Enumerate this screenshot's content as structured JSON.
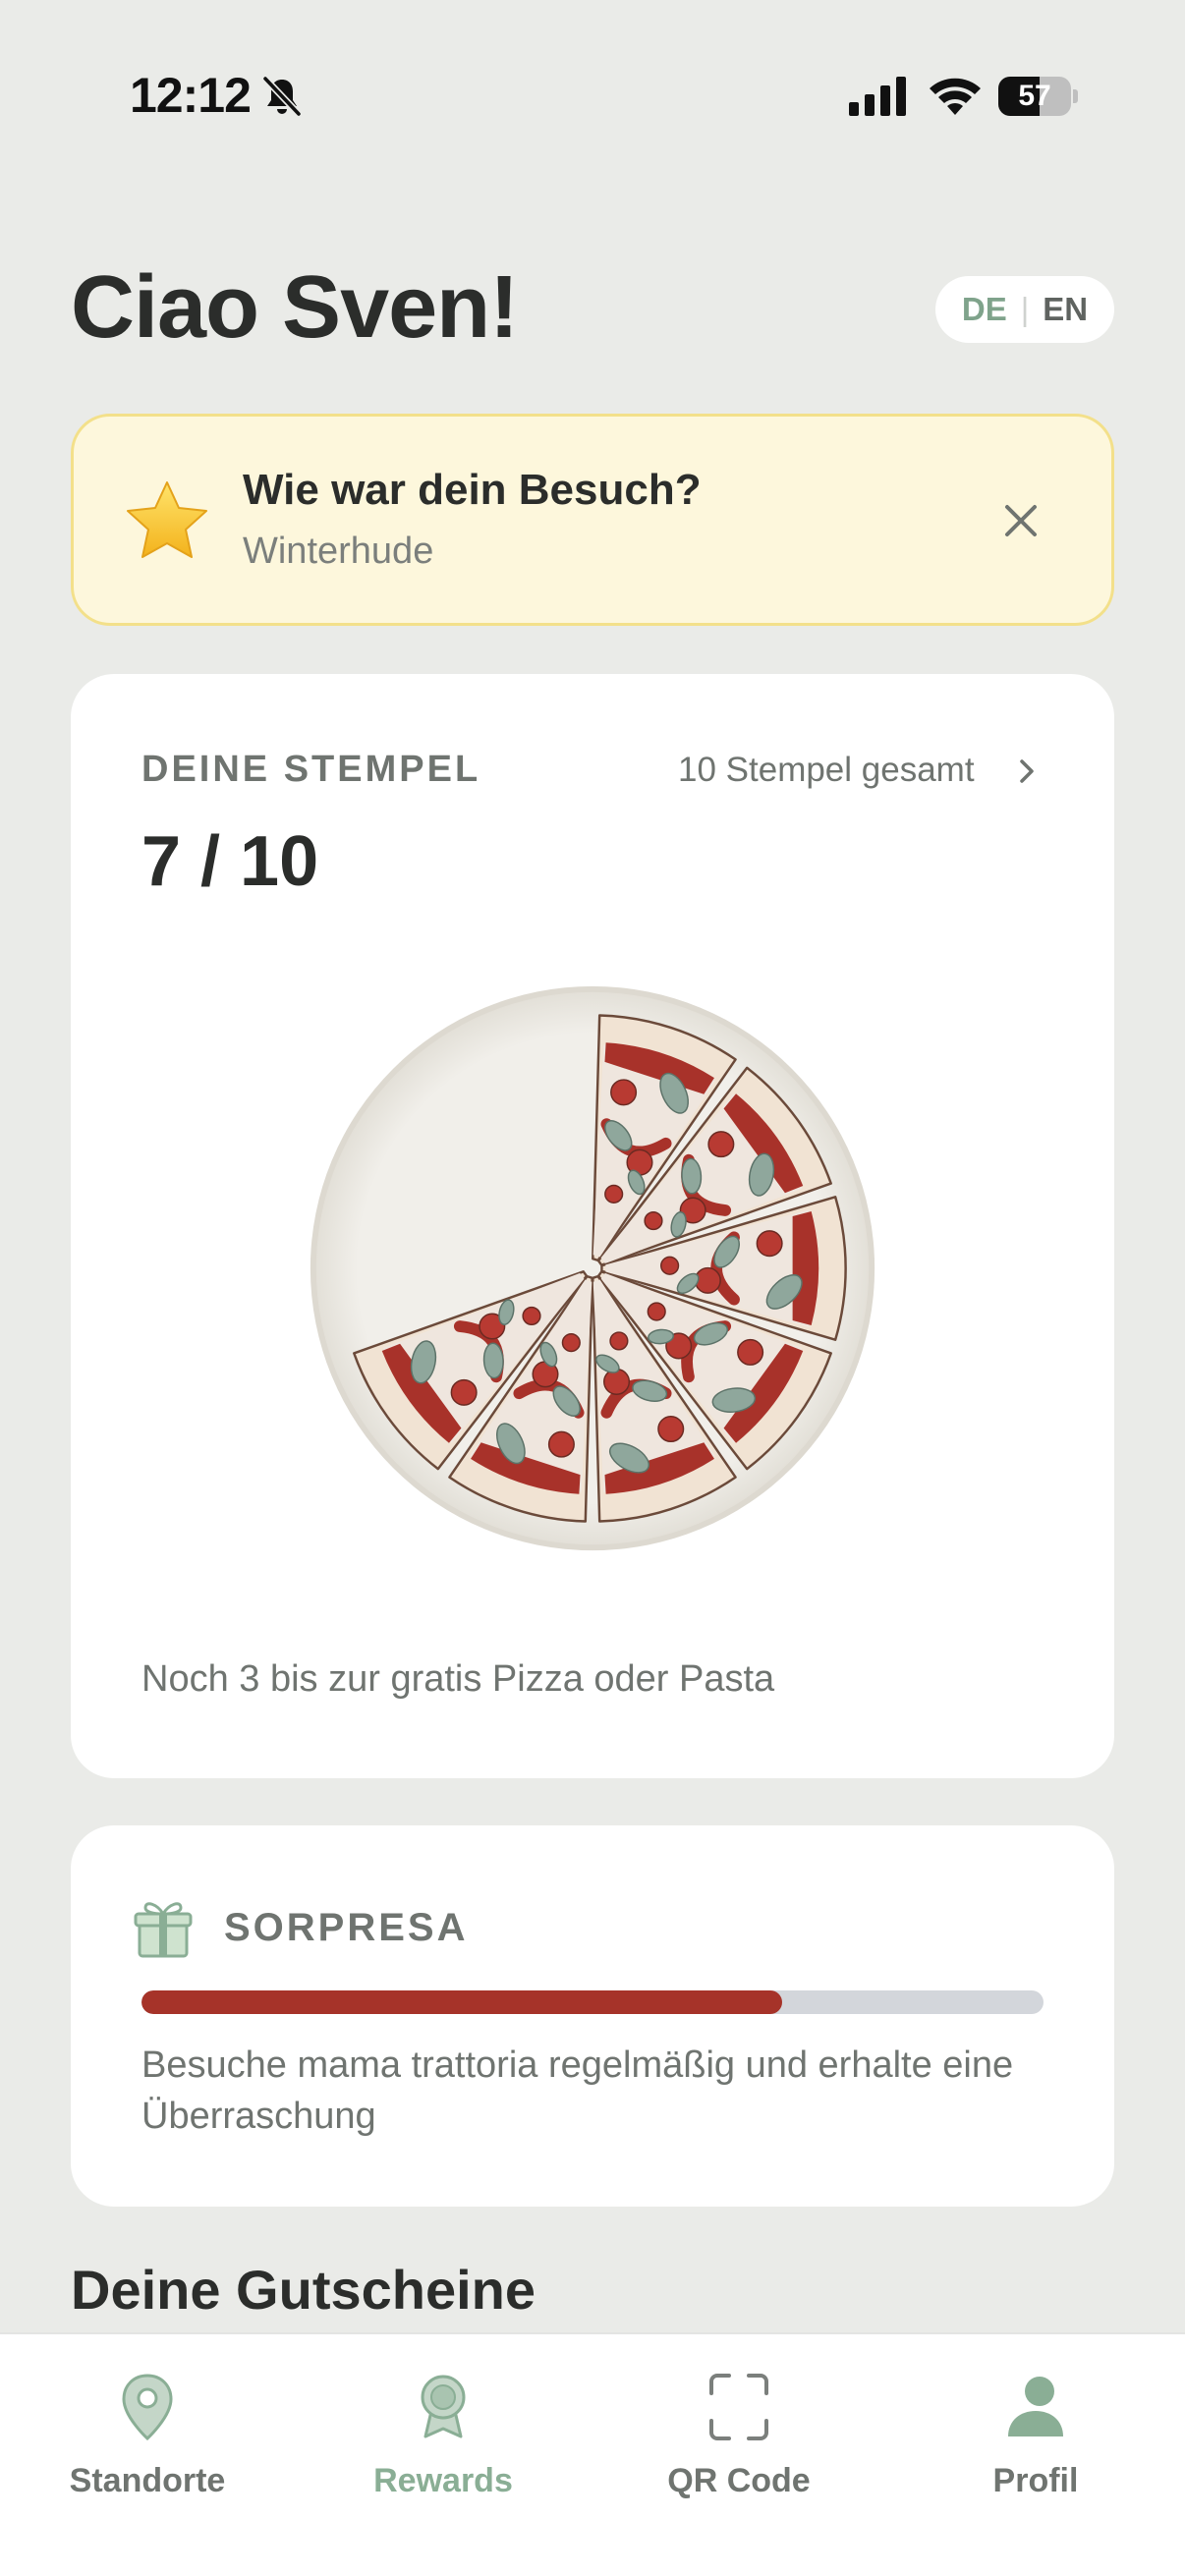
{
  "status_bar": {
    "time": "12:12",
    "battery": "57",
    "battery_level": 0.57,
    "icons": [
      "bell-slash-icon",
      "cellular-signal-icon",
      "wifi-icon",
      "battery-icon"
    ]
  },
  "header": {
    "greeting": "Ciao Sven!",
    "language": {
      "de": "DE",
      "separator": "|",
      "en": "EN",
      "active": "DE"
    }
  },
  "feedback_banner": {
    "icon": "star-icon",
    "title": "Wie war dein Besuch?",
    "subtitle": "Winterhude"
  },
  "stamps": {
    "label": "DEINE STEMPEL",
    "total_link": "10 Stempel gesamt",
    "count": "7 / 10",
    "collected": 7,
    "goal": 10,
    "hint": "Noch 3 bis zur gratis Pizza oder Pasta"
  },
  "surprise": {
    "icon": "gift-icon",
    "label": "SORPRESA",
    "progress": 0.71,
    "text": "Besuche mama trattoria regelmäßig und erhalte eine Überraschung"
  },
  "vouchers": {
    "heading": "Deine Gutscheine"
  },
  "tab_bar": {
    "tabs": [
      {
        "label": "Standorte",
        "icon": "location-pin-icon"
      },
      {
        "label": "Rewards",
        "icon": "award-badge-icon",
        "active": true
      },
      {
        "label": "QR Code",
        "icon": "qr-scan-icon"
      },
      {
        "label": "Profil",
        "icon": "person-icon"
      }
    ]
  },
  "colors": {
    "background": "#eaebe8",
    "accent_green": "#8aae95",
    "progress_red": "#a63329",
    "banner_yellow": "#fdf7dc"
  }
}
